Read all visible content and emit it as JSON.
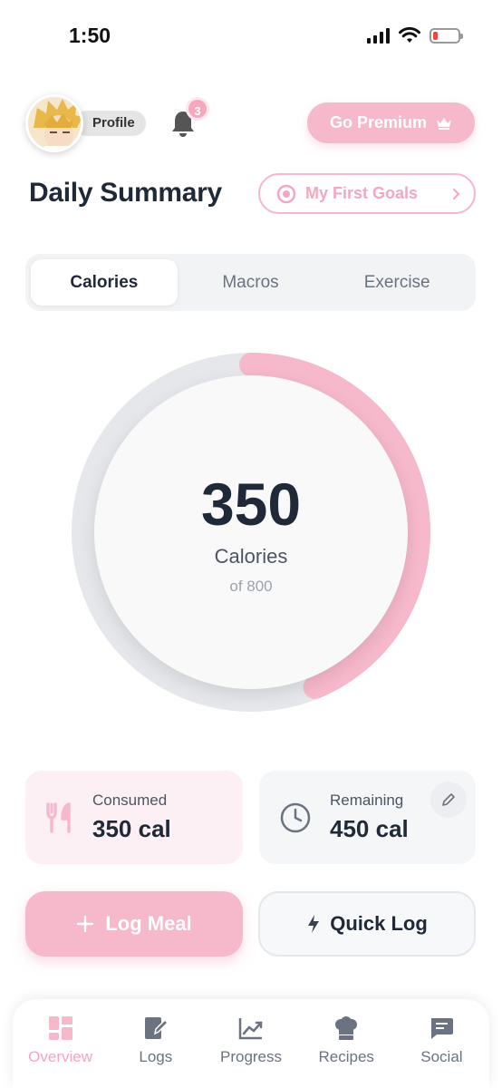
{
  "status_bar": {
    "time": "1:50"
  },
  "header": {
    "profile_label": "Profile",
    "notification_count": "3",
    "premium_label": "Go Premium"
  },
  "summary": {
    "title": "Daily Summary",
    "goals_label": "My First Goals"
  },
  "tabs": [
    {
      "label": "Calories",
      "active": true
    },
    {
      "label": "Macros",
      "active": false
    },
    {
      "label": "Exercise",
      "active": false
    }
  ],
  "ring": {
    "value": "350",
    "unit": "Calories",
    "goal": "of 800",
    "progress_fraction": 0.4375,
    "progress_color": "#f6b8cb",
    "track_color": "#e5e7eb"
  },
  "stats": {
    "consumed": {
      "label": "Consumed",
      "value": "350 cal",
      "icon": "fork-knife-icon"
    },
    "remaining": {
      "label": "Remaining",
      "value": "450 cal",
      "icon": "clock-icon"
    }
  },
  "actions": {
    "log_meal_label": "Log Meal",
    "quick_log_label": "Quick Log"
  },
  "bottom_nav": [
    {
      "label": "Overview",
      "icon": "dashboard-icon",
      "active": true
    },
    {
      "label": "Logs",
      "icon": "notebook-pen-icon",
      "active": false
    },
    {
      "label": "Progress",
      "icon": "chart-icon",
      "active": false
    },
    {
      "label": "Recipes",
      "icon": "chef-hat-icon",
      "active": false
    },
    {
      "label": "Social",
      "icon": "chat-icon",
      "active": false
    }
  ],
  "colors": {
    "accent": "#f6b8cb",
    "accent_text": "#f4a7be",
    "text_primary": "#1f2937"
  }
}
